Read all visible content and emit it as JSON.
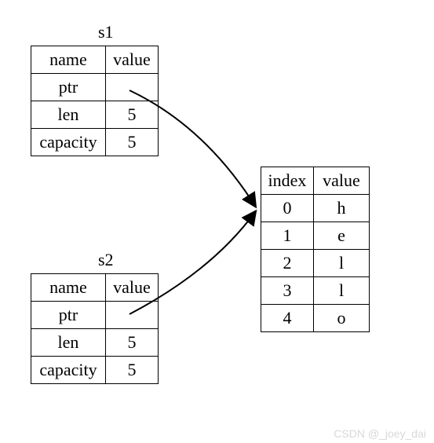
{
  "s1": {
    "title": "s1",
    "headers": {
      "name": "name",
      "value": "value"
    },
    "rows": [
      {
        "name": "ptr",
        "value": ""
      },
      {
        "name": "len",
        "value": "5"
      },
      {
        "name": "capacity",
        "value": "5"
      }
    ]
  },
  "s2": {
    "title": "s2",
    "headers": {
      "name": "name",
      "value": "value"
    },
    "rows": [
      {
        "name": "ptr",
        "value": ""
      },
      {
        "name": "len",
        "value": "5"
      },
      {
        "name": "capacity",
        "value": "5"
      }
    ]
  },
  "heap": {
    "headers": {
      "index": "index",
      "value": "value"
    },
    "rows": [
      {
        "index": "0",
        "value": "h"
      },
      {
        "index": "1",
        "value": "e"
      },
      {
        "index": "2",
        "value": "l"
      },
      {
        "index": "3",
        "value": "l"
      },
      {
        "index": "4",
        "value": "o"
      }
    ]
  },
  "credit": "CSDN @_joey_dai"
}
